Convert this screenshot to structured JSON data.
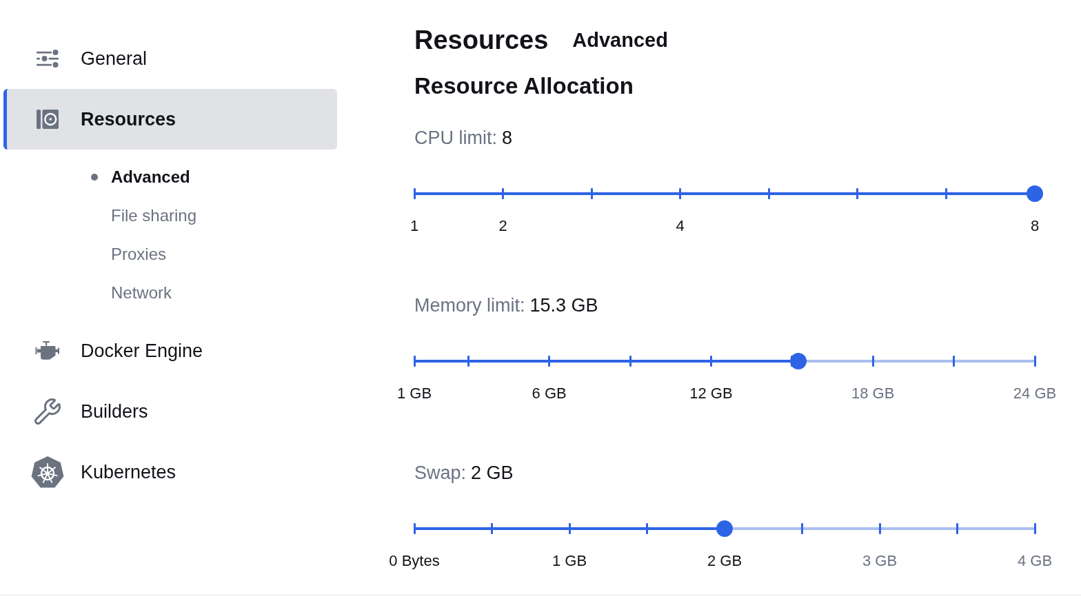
{
  "sidebar": {
    "items": [
      {
        "label": "General",
        "selected": false
      },
      {
        "label": "Resources",
        "selected": true,
        "children": [
          {
            "label": "Advanced",
            "selected": true
          },
          {
            "label": "File sharing",
            "selected": false
          },
          {
            "label": "Proxies",
            "selected": false
          },
          {
            "label": "Network",
            "selected": false
          }
        ]
      },
      {
        "label": "Docker Engine",
        "selected": false
      },
      {
        "label": "Builders",
        "selected": false
      },
      {
        "label": "Kubernetes",
        "selected": false
      }
    ]
  },
  "header": {
    "title": "Resources",
    "subtitle": "Advanced"
  },
  "section_title": "Resource Allocation",
  "sliders": [
    {
      "label": "CPU limit:",
      "value": "8",
      "level": 1,
      "marks": [
        {
          "level": 0,
          "label": "1"
        },
        {
          "level": 0.1429,
          "label": "2"
        },
        {
          "level": 0.2857
        },
        {
          "level": 0.4286,
          "label": "4"
        },
        {
          "level": 0.5714
        },
        {
          "level": 0.7143
        },
        {
          "level": 0.8571
        },
        {
          "level": 1,
          "label": "8"
        }
      ]
    },
    {
      "label": "Memory limit:",
      "value": "15.3 GB",
      "level": 0.619,
      "marks": [
        {
          "level": 0,
          "label": "1 GB"
        },
        {
          "level": 0.087
        },
        {
          "level": 0.2174,
          "label": "6 GB"
        },
        {
          "level": 0.3478
        },
        {
          "level": 0.4783,
          "label": "12 GB"
        },
        {
          "level": 0.6087
        },
        {
          "level": 0.7391,
          "label": "18 GB"
        },
        {
          "level": 0.8696
        },
        {
          "level": 1,
          "label": "24 GB"
        }
      ]
    },
    {
      "label": "Swap:",
      "value": "2 GB",
      "level": 0.5,
      "marks": [
        {
          "level": 0,
          "label": "0 Bytes"
        },
        {
          "level": 0.125
        },
        {
          "level": 0.25,
          "label": "1 GB"
        },
        {
          "level": 0.375
        },
        {
          "level": 0.5,
          "label": "2 GB"
        },
        {
          "level": 0.625
        },
        {
          "level": 0.75,
          "label": "3 GB"
        },
        {
          "level": 0.875
        },
        {
          "level": 1,
          "label": "4 GB"
        }
      ]
    }
  ]
}
